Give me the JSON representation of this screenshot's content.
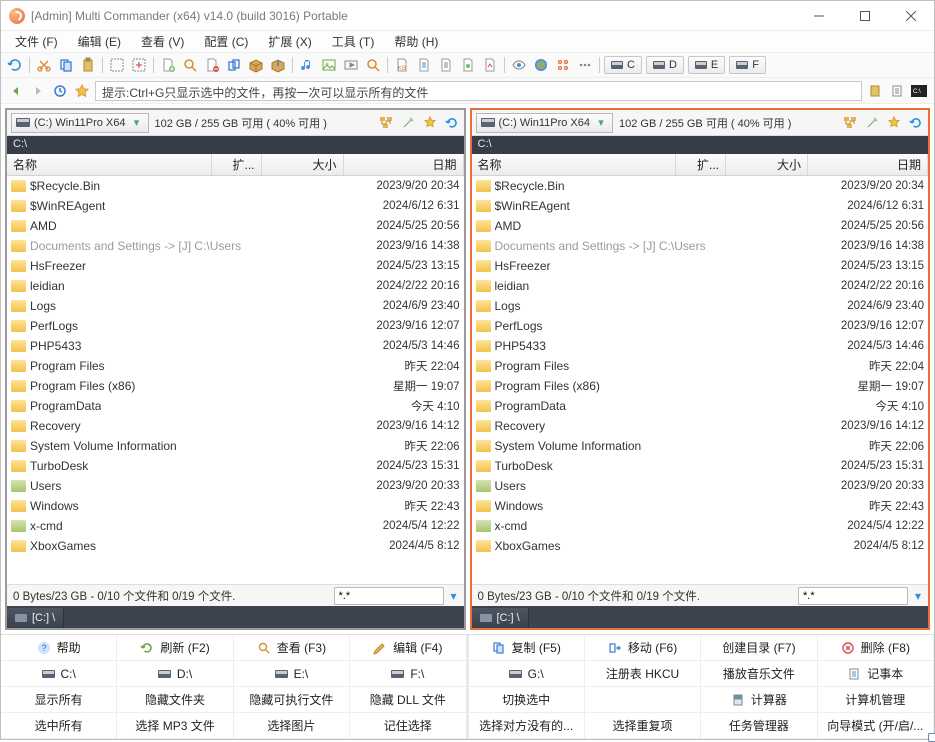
{
  "window": {
    "title": "[Admin] Multi Commander (x64)  v14.0 (build 3016) Portable"
  },
  "menu": [
    "文件 (F)",
    "编辑 (E)",
    "查看 (V)",
    "配置 (C)",
    "扩展 (X)",
    "工具 (T)",
    "帮助 (H)"
  ],
  "nav_hint": "提示:Ctrl+G只显示选中的文件，再按一次可以显示所有的文件",
  "drive_letters": [
    "C",
    "D",
    "E",
    "F"
  ],
  "columns": {
    "name": "名称",
    "ext": "扩...",
    "size": "大小",
    "date": "日期"
  },
  "panel": {
    "drive_label": "(C:) Win11Pro X64",
    "space": "102 GB / 255 GB 可用 ( 40% 可用 )",
    "path": "C:\\",
    "status": "0 Bytes/23 GB - 0/10 个文件和 0/19 个文件.",
    "filter": "*.*",
    "tab": "[C:] \\"
  },
  "files": [
    {
      "name": "$Recycle.Bin",
      "date": "2023/9/20 20:34",
      "cls": "folder"
    },
    {
      "name": "$WinREAgent",
      "date": "2024/6/12 6:31",
      "cls": "folder"
    },
    {
      "name": "AMD",
      "date": "2024/5/25 20:56",
      "cls": "folder"
    },
    {
      "name": "Documents and Settings ->  [J] C:\\Users",
      "date": "2023/9/16 14:38",
      "cls": "link",
      "muted": true
    },
    {
      "name": "HsFreezer",
      "date": "2024/5/23 13:15",
      "cls": "folder"
    },
    {
      "name": "leidian",
      "date": "2024/2/22 20:16",
      "cls": "folder"
    },
    {
      "name": "Logs",
      "date": "2024/6/9 23:40",
      "cls": "folder"
    },
    {
      "name": "PerfLogs",
      "date": "2023/9/16 12:07",
      "cls": "folder"
    },
    {
      "name": "PHP5433",
      "date": "2024/5/3 14:46",
      "cls": "folder"
    },
    {
      "name": "Program Files",
      "date": "昨天 22:04",
      "cls": "folder"
    },
    {
      "name": "Program Files (x86)",
      "date": "星期一 19:07",
      "cls": "folder"
    },
    {
      "name": "ProgramData",
      "date": "今天 4:10",
      "cls": "folder"
    },
    {
      "name": "Recovery",
      "date": "2023/9/16 14:12",
      "cls": "folder"
    },
    {
      "name": "System Volume Information",
      "date": "昨天 22:06",
      "cls": "folder"
    },
    {
      "name": "TurboDesk",
      "date": "2024/5/23 15:31",
      "cls": "folder"
    },
    {
      "name": "Users",
      "date": "2023/9/20 20:33",
      "cls": "special"
    },
    {
      "name": "Windows",
      "date": "昨天 22:43",
      "cls": "folder"
    },
    {
      "name": "x-cmd",
      "date": "2024/5/4 12:22",
      "cls": "special"
    },
    {
      "name": "XboxGames",
      "date": "2024/4/5 8:12",
      "cls": "folder"
    }
  ],
  "commands": [
    [
      {
        "label": "帮助",
        "icon": "help"
      },
      {
        "label": "刷新 (F2)",
        "icon": "refresh"
      },
      {
        "label": "查看 (F3)",
        "icon": "view"
      },
      {
        "label": "编辑 (F4)",
        "icon": "edit"
      },
      {
        "label": "复制 (F5)",
        "icon": "copy"
      },
      {
        "label": "移动 (F6)",
        "icon": "move"
      },
      {
        "label": "创建目录 (F7)",
        "icon": ""
      },
      {
        "label": "删除 (F8)",
        "icon": "delete"
      }
    ],
    [
      {
        "label": "C:\\",
        "icon": "drive"
      },
      {
        "label": "D:\\",
        "icon": "drive"
      },
      {
        "label": "E:\\",
        "icon": "drive"
      },
      {
        "label": "F:\\",
        "icon": "drive"
      },
      {
        "label": "G:\\",
        "icon": "drive"
      },
      {
        "label": "注册表 HKCU",
        "icon": ""
      },
      {
        "label": "播放音乐文件",
        "icon": ""
      },
      {
        "label": "记事本",
        "icon": "note"
      }
    ],
    [
      {
        "label": "显示所有",
        "icon": ""
      },
      {
        "label": "隐藏文件夹",
        "icon": ""
      },
      {
        "label": "隐藏可执行文件",
        "icon": ""
      },
      {
        "label": "隐藏 DLL 文件",
        "icon": ""
      },
      {
        "label": "切换选中",
        "icon": ""
      },
      {
        "label": "",
        "icon": ""
      },
      {
        "label": "计算器",
        "icon": "calc"
      },
      {
        "label": "计算机管理",
        "icon": ""
      }
    ],
    [
      {
        "label": "选中所有",
        "icon": ""
      },
      {
        "label": "选择 MP3 文件",
        "icon": ""
      },
      {
        "label": "选择图片",
        "icon": ""
      },
      {
        "label": "记住选择",
        "icon": ""
      },
      {
        "label": "选择对方没有的...",
        "icon": ""
      },
      {
        "label": "选择重复项",
        "icon": ""
      },
      {
        "label": "任务管理器",
        "icon": ""
      },
      {
        "label": "向导模式 (开/启/...",
        "icon": ""
      }
    ]
  ]
}
